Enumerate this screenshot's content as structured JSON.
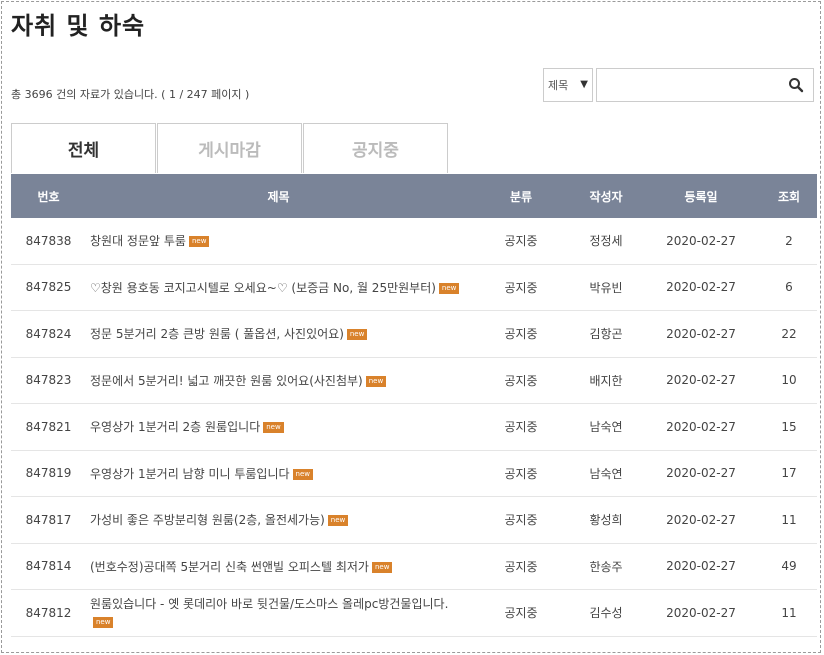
{
  "page": {
    "title": "자취 및 하숙"
  },
  "summary": {
    "text": "총 3696 건의 자료가 있습니다. ( 1 / 247 페이지 )"
  },
  "search": {
    "field_selected": "제목",
    "query_value": "",
    "button_icon": "search-icon"
  },
  "tabs": [
    {
      "label": "전체",
      "active": true
    },
    {
      "label": "게시마감",
      "active": false
    },
    {
      "label": "공지중",
      "active": false
    }
  ],
  "table": {
    "headers": {
      "num": "번호",
      "subject": "제목",
      "category": "분류",
      "author": "작성자",
      "date": "등록일",
      "views": "조회"
    },
    "rows": [
      {
        "num": "847838",
        "subject": "창원대 정문앞 투룸",
        "badge": "new",
        "category": "공지중",
        "author": "정정세",
        "date": "2020-02-27",
        "views": "2"
      },
      {
        "num": "847825",
        "subject": "♡창원 용호동 코지고시텔로 오세요~♡ (보증금 No, 월 25만원부터)",
        "badge": "new",
        "category": "공지중",
        "author": "박유빈",
        "date": "2020-02-27",
        "views": "6"
      },
      {
        "num": "847824",
        "subject": "정문 5분거리 2층 큰방 원룸 ( 풀옵션, 사진있어요)",
        "badge": "new",
        "category": "공지중",
        "author": "김항곤",
        "date": "2020-02-27",
        "views": "22"
      },
      {
        "num": "847823",
        "subject": "정문에서 5분거리! 넓고 깨끗한 원룸 있어요(사진첨부)",
        "badge": "new",
        "category": "공지중",
        "author": "배지한",
        "date": "2020-02-27",
        "views": "10"
      },
      {
        "num": "847821",
        "subject": "우영상가 1분거리 2층 원룸입니다",
        "badge": "new",
        "category": "공지중",
        "author": "남숙연",
        "date": "2020-02-27",
        "views": "15"
      },
      {
        "num": "847819",
        "subject": "우영상가 1분거리 남향 미니 투룸입니다",
        "badge": "new",
        "category": "공지중",
        "author": "남숙연",
        "date": "2020-02-27",
        "views": "17"
      },
      {
        "num": "847817",
        "subject": "가성비 좋은 주방분리형 원룸(2층, 올전세가능)",
        "badge": "new",
        "category": "공지중",
        "author": "황성희",
        "date": "2020-02-27",
        "views": "11"
      },
      {
        "num": "847814",
        "subject": "(번호수정)공대쪽 5분거리 신축 썬앤빌 오피스텔 최저가",
        "badge": "new",
        "category": "공지중",
        "author": "한송주",
        "date": "2020-02-27",
        "views": "49"
      },
      {
        "num": "847812",
        "subject": "원룸있습니다 - 옛 롯데리아 바로 뒷건물/도스마스 올레pc방건물입니다.",
        "badge": "new",
        "category": "공지중",
        "author": "김수성",
        "date": "2020-02-27",
        "views": "11"
      }
    ]
  },
  "colors": {
    "header_bg": "#7a8498",
    "badge_bg": "#d9822b"
  }
}
